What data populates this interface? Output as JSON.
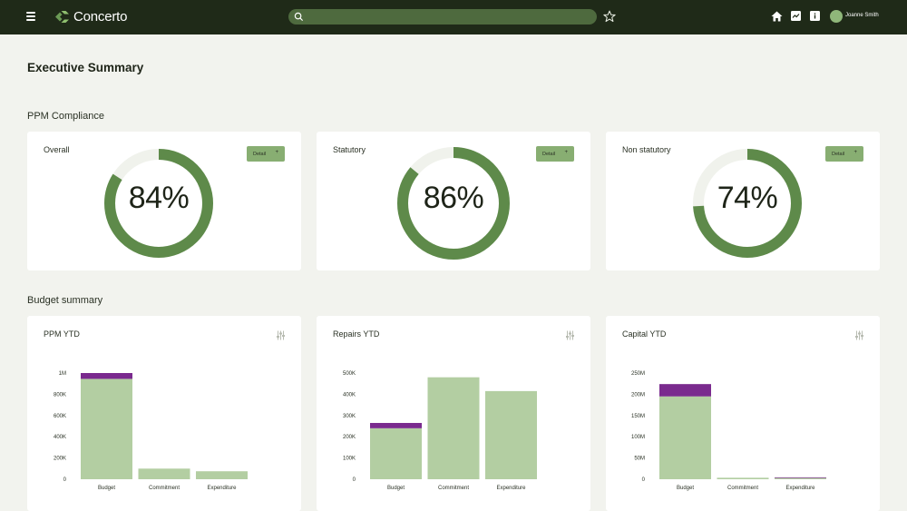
{
  "app": {
    "name": "Concerto"
  },
  "header": {
    "search_placeholder": "",
    "user_name": "Joanne Smith"
  },
  "page": {
    "title": "Executive Summary"
  },
  "colors": {
    "topbar": "#1f2a18",
    "brand_green": "#6b9a55",
    "donut_track": "#f0f2ec",
    "donut_fill": "#5e8a4a",
    "bar_green": "#b3cea2",
    "bar_purple": "#7a2a8e"
  },
  "compliance": {
    "title": "PPM Compliance",
    "cards": [
      {
        "label": "Overall",
        "value_text": "84%",
        "value": 84,
        "detail_label": "Detail",
        "detail_icon": "+"
      },
      {
        "label": "Statutory",
        "value_text": "86%",
        "value": 86,
        "detail_label": "Detail",
        "detail_icon": "+"
      },
      {
        "label": "Non statutory",
        "value_text": "74%",
        "value": 74,
        "detail_label": "Detail",
        "detail_icon": "+"
      }
    ]
  },
  "budget": {
    "title": "Budget summary",
    "cards": [
      {
        "label": "PPM YTD",
        "filter_icon": "sliders-icon"
      },
      {
        "label": "Repairs YTD",
        "filter_icon": "sliders-icon"
      },
      {
        "label": "Capital YTD",
        "filter_icon": "sliders-icon"
      }
    ]
  },
  "chart_data": [
    {
      "type": "bar",
      "title": "PPM YTD",
      "categories": [
        "Budget",
        "Commitment",
        "Expenditure"
      ],
      "yticks": [
        "0",
        "200K",
        "400K",
        "600K",
        "800K",
        "1M"
      ],
      "ylim": [
        0,
        1000000
      ],
      "series": [
        {
          "values": [
            945000,
            100000,
            75000
          ]
        },
        {
          "values": [
            55000,
            0,
            0
          ]
        }
      ]
    },
    {
      "type": "bar",
      "title": "Repairs YTD",
      "categories": [
        "Budget",
        "Commitment",
        "Expenditure"
      ],
      "yticks": [
        "0",
        "100K",
        "200K",
        "300K",
        "400K",
        "500K"
      ],
      "ylim": [
        0,
        500000
      ],
      "series": [
        {
          "values": [
            240000,
            480000,
            415000
          ]
        },
        {
          "values": [
            25000,
            0,
            0
          ]
        }
      ]
    },
    {
      "type": "bar",
      "title": "Capital YTD",
      "categories": [
        "Budget",
        "Commitment",
        "Expenditure"
      ],
      "yticks": [
        "0",
        "50M",
        "100M",
        "150M",
        "200M",
        "250M"
      ],
      "ylim": [
        0,
        250000000
      ],
      "series": [
        {
          "values": [
            195000000,
            3500000,
            3000000
          ]
        },
        {
          "values": [
            29000000,
            0,
            1500000
          ]
        }
      ]
    }
  ]
}
